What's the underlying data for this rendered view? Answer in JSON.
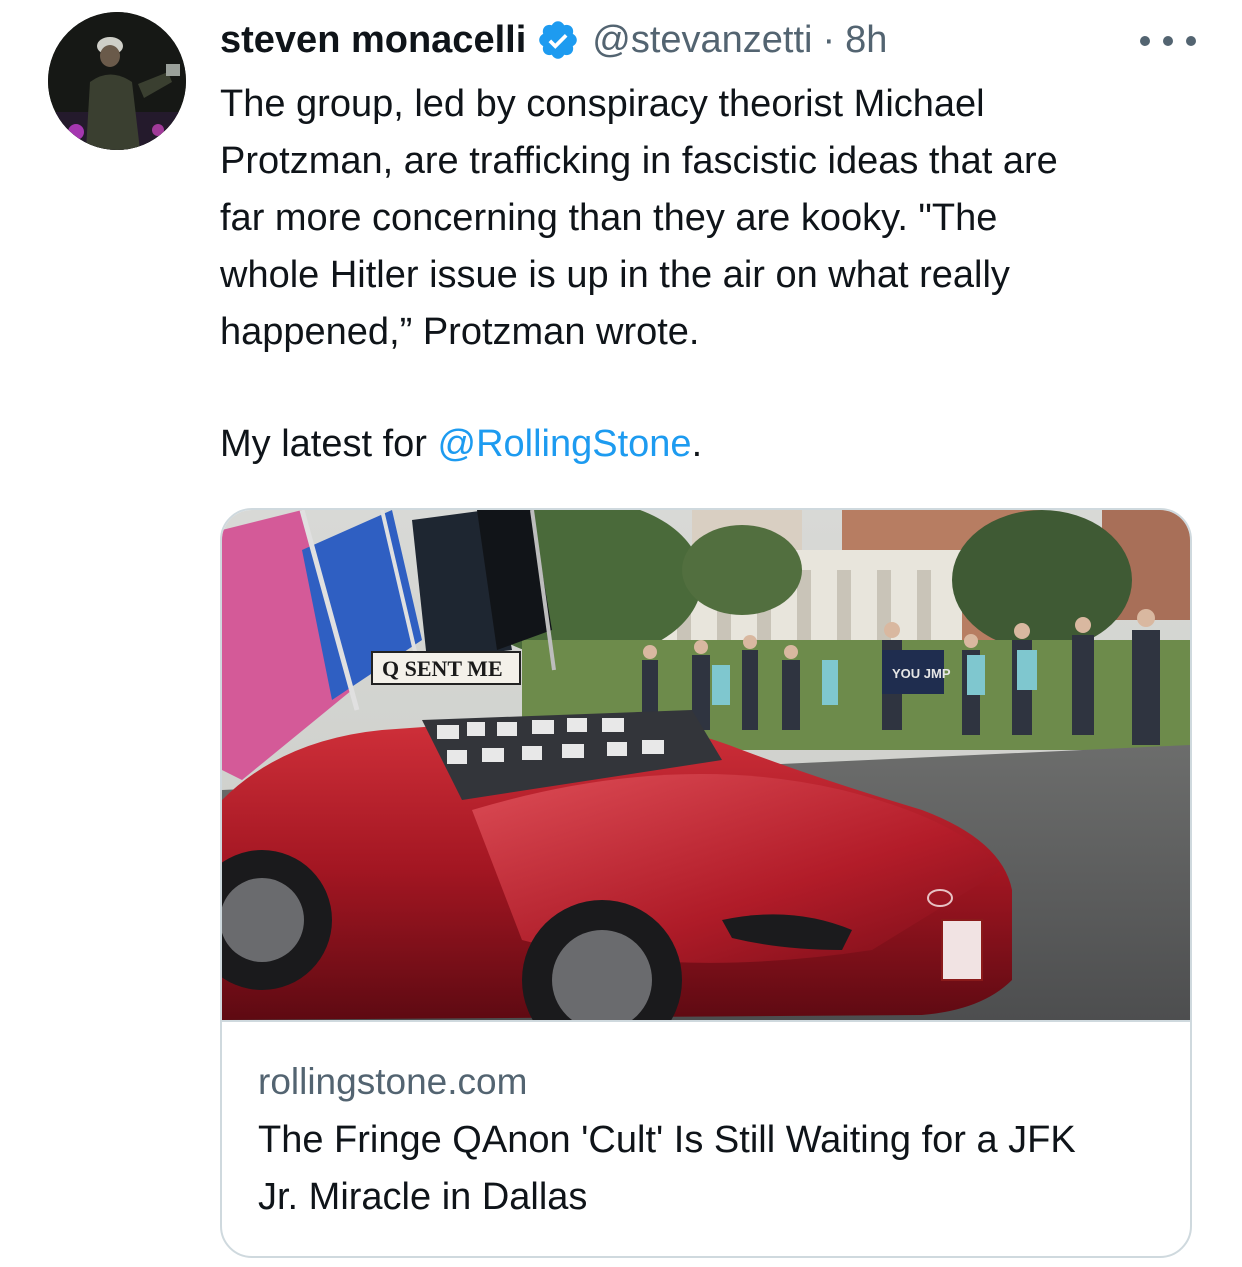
{
  "tweet": {
    "author_name": "steven monacelli",
    "handle": "@stevanzetti",
    "separator": "·",
    "time": "8h",
    "body_lines": [
      "The group, led by conspiracy theorist Michael",
      "Protzman, are trafficking in fascistic ideas that are",
      "far more concerning than they are kooky. \"The",
      "whole Hitler issue is up in the air on what really",
      "happened,” Protzman wrote."
    ],
    "latest_prefix": "My latest for ",
    "latest_mention": "@RollingStone",
    "latest_suffix": "."
  },
  "card": {
    "domain": "rollingstone.com",
    "title_lines": [
      "The Fringe QAnon 'Cult' Is Still Waiting for a JFK",
      "Jr. Miracle in Dallas"
    ],
    "image_sign_text": "Q SENT ME",
    "image_flag_text": "YOU JMP"
  },
  "colors": {
    "link": "#1d9bf0",
    "secondary_text": "#536471",
    "border": "#cfd9de",
    "verified": "#1d9bf0"
  },
  "icons": {
    "verified": "verified-badge-icon",
    "more": "more-options-icon"
  }
}
